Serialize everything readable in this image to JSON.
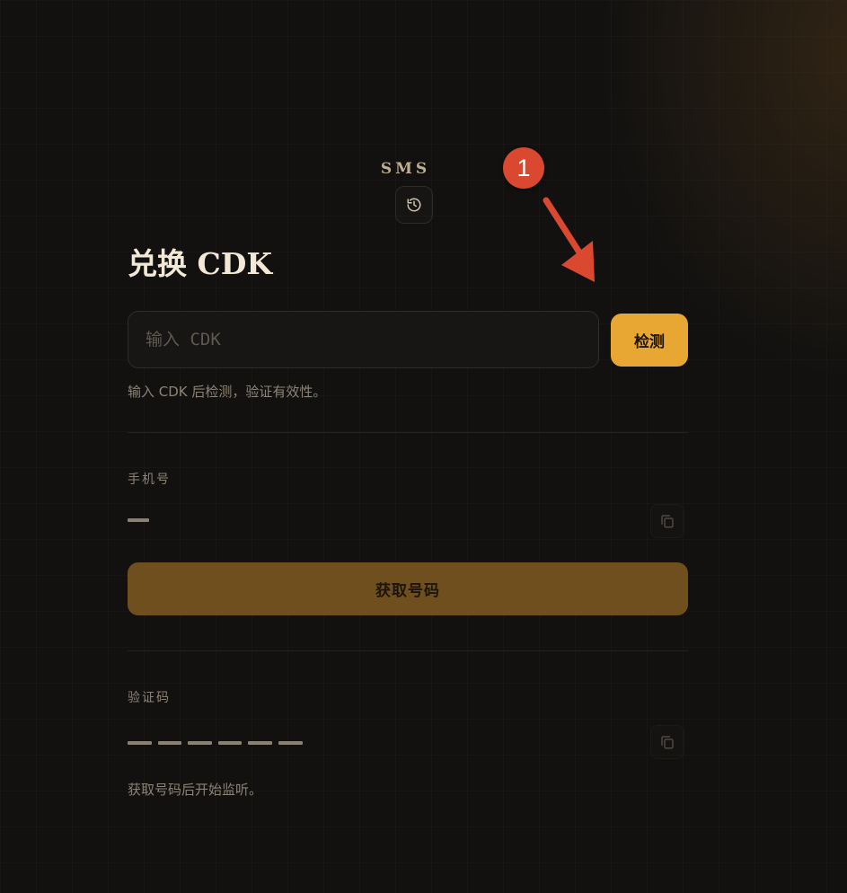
{
  "app": {
    "brand": "SMS"
  },
  "header": {
    "history_icon": "history-icon"
  },
  "cdk": {
    "title": "兑换 CDK",
    "input_placeholder": "输入 CDK",
    "input_value": "",
    "detect_label": "检测",
    "hint": "输入 CDK 后检测，验证有效性。"
  },
  "phone": {
    "label": "手机号",
    "value": "—",
    "copy_icon": "copy-icon",
    "get_button_label": "获取号码"
  },
  "code": {
    "label": "验证码",
    "placeholder_digits": 6,
    "copy_icon": "copy-icon",
    "hint": "获取号码后开始监听。"
  },
  "annotation": {
    "step_number": "1",
    "arrow_icon": "arrow-icon"
  },
  "colors": {
    "background": "#121110",
    "accent": "#e8a633",
    "accent_disabled": "#6f4f1e",
    "badge": "#d9482f",
    "arrow": "#d9482f"
  }
}
